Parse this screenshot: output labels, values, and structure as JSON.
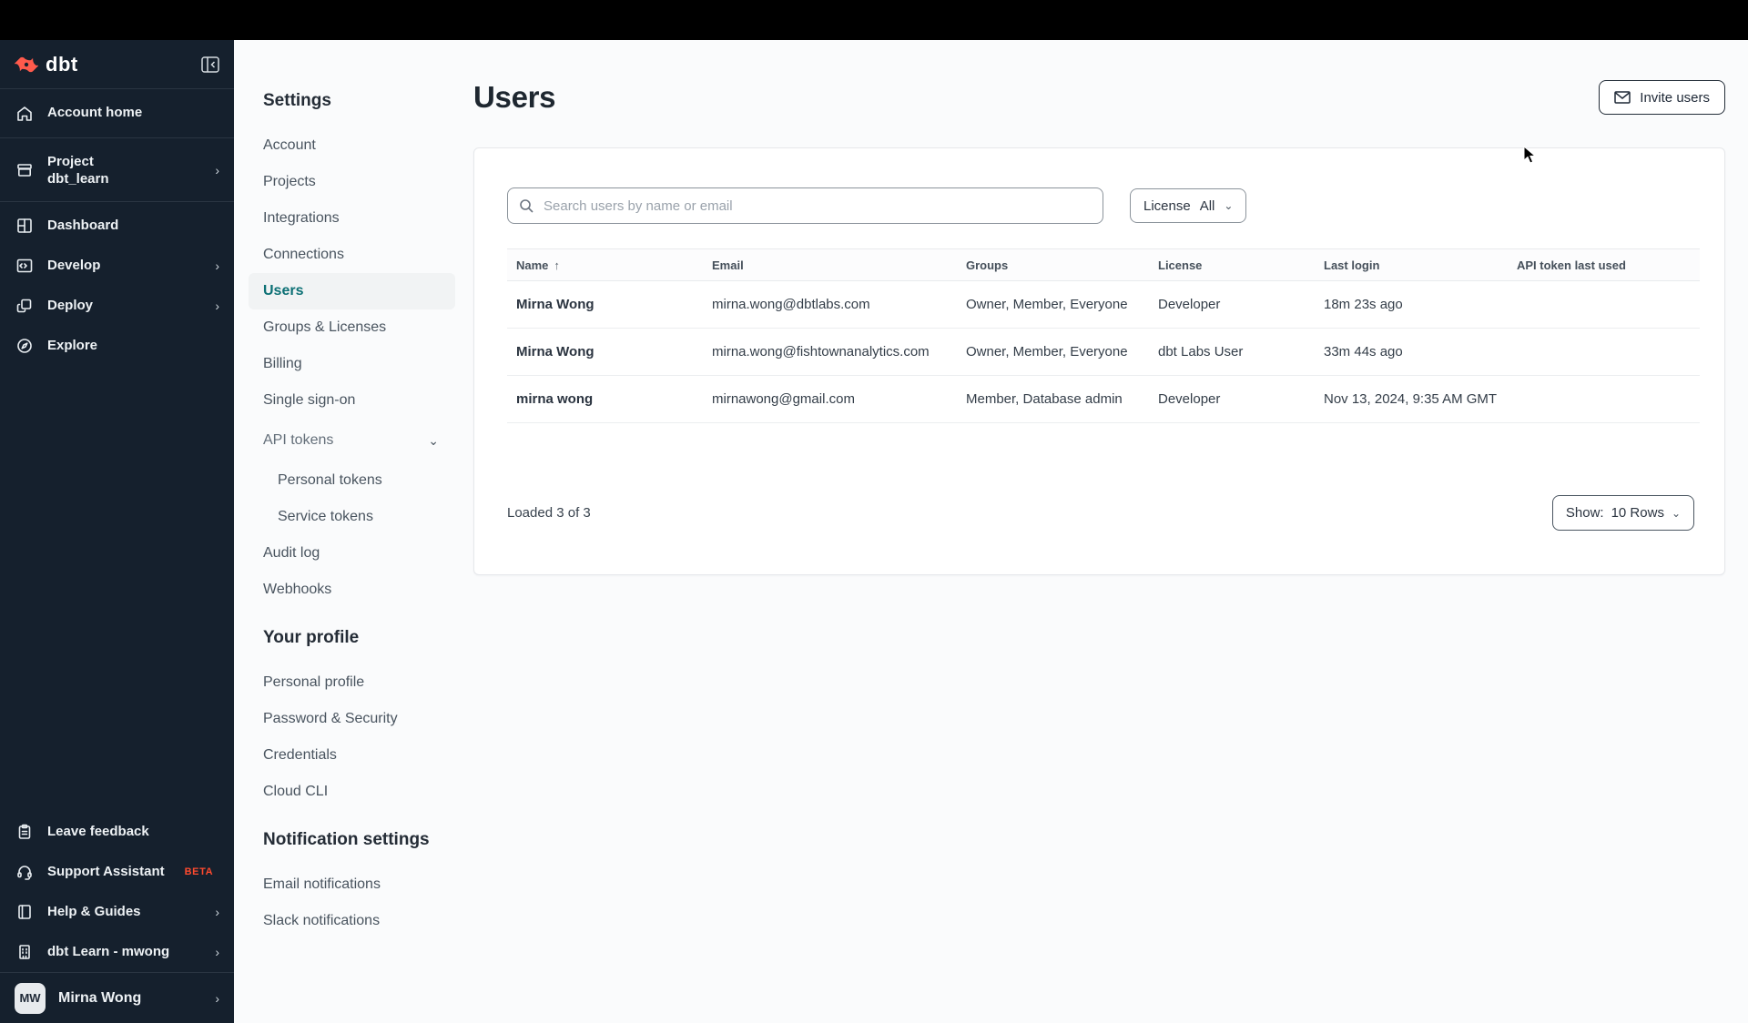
{
  "colors": {
    "brand_orange": "#ff5a4c",
    "beta_badge": "#ff4a2e",
    "selected_teal": "#0c7075",
    "sidebar_bg": "#15202d",
    "topbar_black": "#000000"
  },
  "sidebar": {
    "logo_text": "dbt",
    "items_top": [
      {
        "icon": "home-icon",
        "label": "Account home"
      },
      {
        "icon": "project-box-icon",
        "label": "Project",
        "sublabel": "dbt_learn",
        "chevron": "›"
      },
      {
        "icon": "dashboard-grid-icon",
        "label": "Dashboard"
      },
      {
        "icon": "develop-code-icon",
        "label": "Develop",
        "chevron": "›"
      },
      {
        "icon": "deploy-icon",
        "label": "Deploy",
        "chevron": "›"
      },
      {
        "icon": "explore-icon",
        "label": "Explore"
      }
    ],
    "items_bottom": [
      {
        "icon": "feedback-clipboard-icon",
        "label": "Leave feedback"
      },
      {
        "icon": "headset-icon",
        "label": "Support Assistant",
        "badge": "BETA"
      },
      {
        "icon": "book-icon",
        "label": "Help & Guides",
        "chevron": "›"
      },
      {
        "icon": "building-icon",
        "label": "dbt Learn - mwong",
        "chevron": "›"
      }
    ],
    "user": {
      "initials": "MW",
      "name": "Mirna Wong",
      "chevron": "›"
    }
  },
  "settings_nav": {
    "title": "Settings",
    "items": [
      {
        "label": "Account"
      },
      {
        "label": "Projects"
      },
      {
        "label": "Integrations"
      },
      {
        "label": "Connections"
      },
      {
        "label": "Users",
        "selected": true
      },
      {
        "label": "Groups & Licenses"
      },
      {
        "label": "Billing"
      },
      {
        "label": "Single sign-on"
      }
    ],
    "api_tokens": {
      "label": "API tokens",
      "chevron": "⌄",
      "children": [
        {
          "label": "Personal tokens"
        },
        {
          "label": "Service tokens"
        }
      ]
    },
    "items_after": [
      {
        "label": "Audit log"
      },
      {
        "label": "Webhooks"
      }
    ],
    "profile": {
      "title": "Your profile",
      "items": [
        {
          "label": "Personal profile"
        },
        {
          "label": "Password & Security"
        },
        {
          "label": "Credentials"
        },
        {
          "label": "Cloud CLI"
        }
      ]
    },
    "notifications": {
      "title": "Notification settings",
      "items": [
        {
          "label": "Email notifications"
        },
        {
          "label": "Slack notifications"
        }
      ]
    }
  },
  "main": {
    "title": "Users",
    "invite_button_label": "Invite users",
    "search": {
      "placeholder": "Search users by name or email"
    },
    "license_filter": {
      "label": "License",
      "value": "All",
      "chevron": "⌄"
    },
    "table": {
      "columns": [
        "Name",
        "Email",
        "Groups",
        "License",
        "Last login",
        "API token last used"
      ],
      "sort_arrow": "↑",
      "rows": [
        {
          "name": "Mirna Wong",
          "email": "mirna.wong@dbtlabs.com",
          "groups": "Owner, Member, Everyone",
          "license": "Developer",
          "last_login": "18m 23s ago",
          "api_token_last_used": ""
        },
        {
          "name": "Mirna Wong",
          "email": "mirna.wong@fishtownanalytics.com",
          "groups": "Owner, Member, Everyone",
          "license": "dbt Labs User",
          "last_login": "33m 44s ago",
          "api_token_last_used": ""
        },
        {
          "name": "mirna wong",
          "email": "mirnawong@gmail.com",
          "groups": "Member, Database admin",
          "license": "Developer",
          "last_login": "Nov 13, 2024, 9:35 AM GMT",
          "api_token_last_used": ""
        }
      ],
      "footer": {
        "loaded": "Loaded 3 of 3",
        "show_label": "Show:",
        "show_value": "10 Rows",
        "chevron": "⌄"
      }
    }
  }
}
